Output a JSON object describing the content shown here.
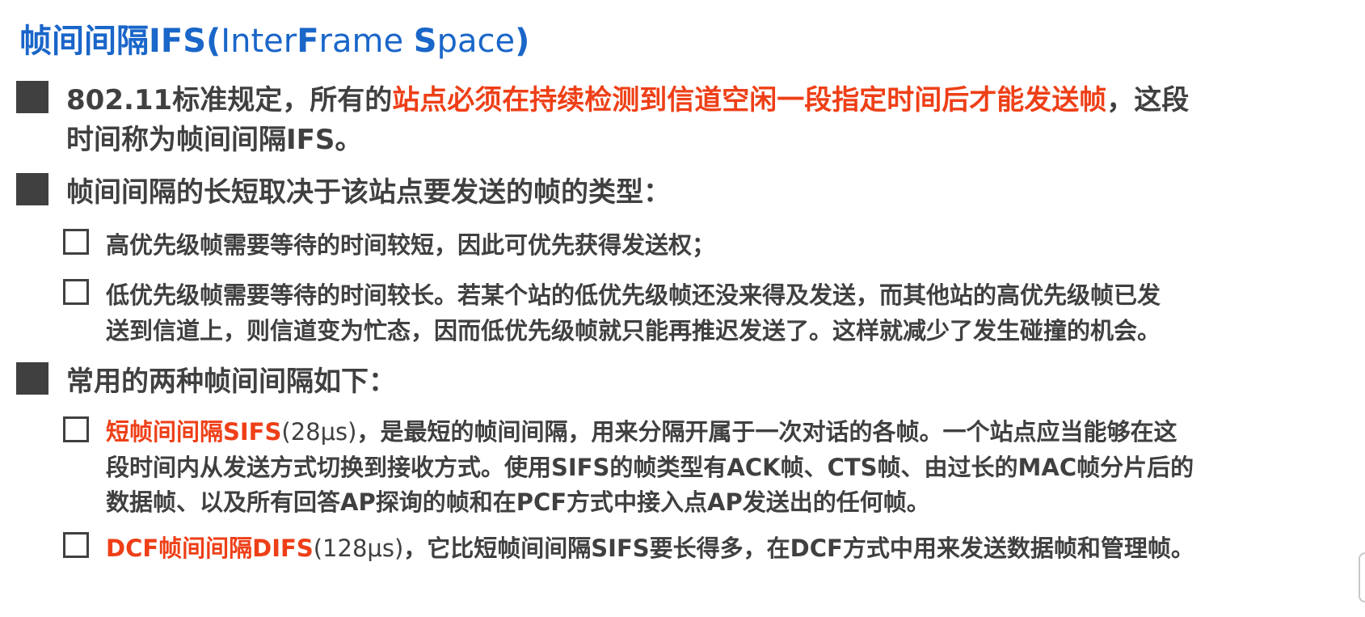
{
  "title": {
    "main": "帧间间隔IFS(",
    "light1": "Inter",
    "bold_f": "F",
    "light2": "rame ",
    "bold_s": "S",
    "light3": "pace",
    "close": ")"
  },
  "bullets": [
    {
      "pre": "802.11标准规定，所有的",
      "highlight": "站点必须在持续检测到信道空闲一段指定时间后才能发送帧",
      "post": "，这段",
      "line2": "时间称为帧间间隔IFS。"
    },
    {
      "text": "帧间间隔的长短取决于该站点要发送的帧的类型："
    },
    {
      "text": "常用的两种帧间间隔如下："
    }
  ],
  "sub_items": [
    {
      "text": "高优先级帧需要等待的时间较短，因此可优先获得发送权；"
    },
    {
      "line1": "低优先级帧需要等待的时间较长。若某个站的低优先级帧还没来得及发送，而其他站的高优先级帧已发",
      "line2": "送到信道上，则信道变为忙态，因而低优先级帧就只能再推迟发送了。这样就减少了发生碰撞的机会。"
    },
    {
      "highlight": "短帧间间隔SIFS",
      "value": "(28μs)",
      "rest1": "，是最短的帧间间隔，用来分隔开属于一次对话的各帧。一个站点应当能够在这",
      "line2": "段时间内从发送方式切换到接收方式。使用SIFS的帧类型有ACK帧、CTS帧、由过长的MAC帧分片后的",
      "line3": "数据帧、以及所有回答AP探询的帧和在PCF方式中接入点AP发送出的任何帧。"
    },
    {
      "highlight": "DCF帧间间隔DIFS",
      "value": "(128μs)",
      "rest1": "，它比短帧间间隔SIFS要长得多，在DCF方式中用来发送数据帧和管理帧。"
    }
  ],
  "colors": {
    "title": "#1a66c9",
    "highlight": "#ee3f17",
    "body_text": "#404040"
  }
}
